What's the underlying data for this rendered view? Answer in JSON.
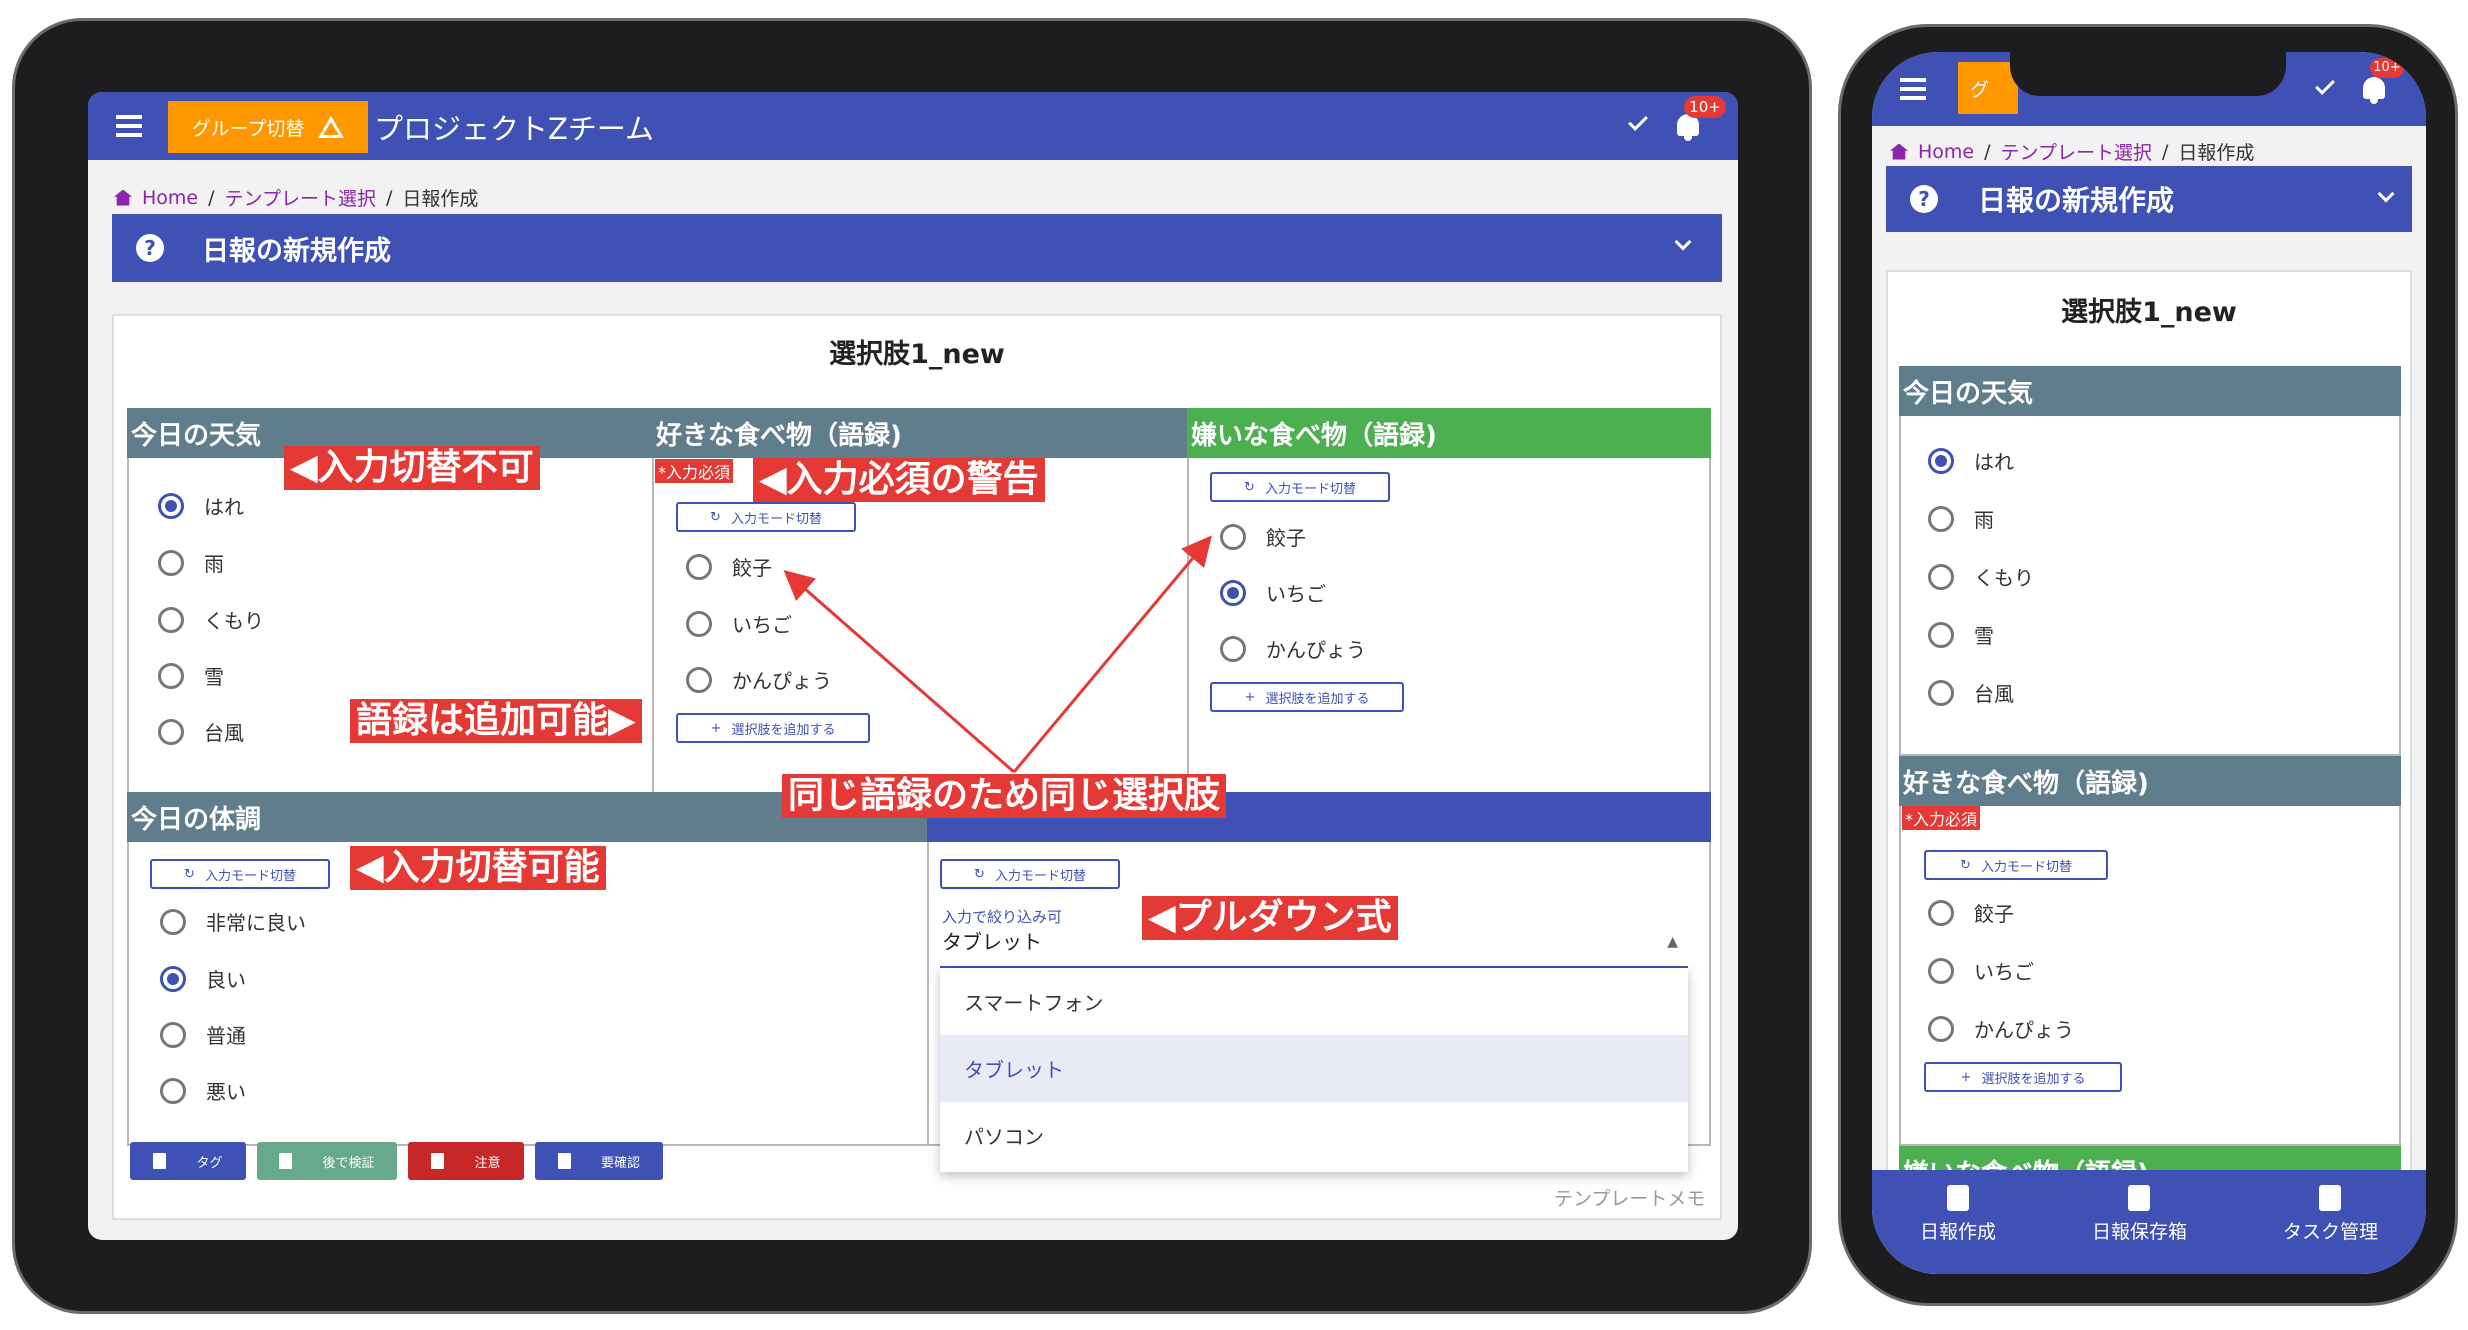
{
  "app": {
    "group_button": "グループ切替",
    "title": "プロジェクトZチーム",
    "notification_badge": "10+",
    "phone_group_button": "グ"
  },
  "breadcrumb": {
    "home": "Home",
    "template": "テンプレート選択",
    "current": "日報作成"
  },
  "banner": {
    "help": "?",
    "title": "日報の新規作成"
  },
  "form": {
    "title": "選択肢1_new",
    "weather": {
      "heading": "今日の天気",
      "options": [
        "はれ",
        "雨",
        "くもり",
        "雪",
        "台風"
      ],
      "selected": "はれ"
    },
    "food_like": {
      "heading": "好きな食べ物（語録)",
      "required": "*入力必須",
      "mode_button": "入力モード切替",
      "options": [
        "餃子",
        "いちご",
        "かんぴょう"
      ],
      "add_button": "選択肢を追加する"
    },
    "food_dislike": {
      "heading": "嫌いな食べ物（語録)",
      "mode_button": "入力モード切替",
      "options": [
        "餃子",
        "いちご",
        "かんぴょう"
      ],
      "selected": "いちご",
      "add_button": "選択肢を追加する"
    },
    "condition": {
      "heading": "今日の体調",
      "mode_button": "入力モード切替",
      "options": [
        "非常に良い",
        "良い",
        "普通",
        "悪い"
      ],
      "selected": "良い"
    },
    "device": {
      "mode_button": "入力モード切替",
      "filter_label": "入力で絞り込み可",
      "value": "タブレット",
      "options": [
        "スマートフォン",
        "タブレット",
        "パソコン"
      ],
      "selected": "タブレット"
    },
    "tags": [
      "タグ",
      "後で検証",
      "注意",
      "要確認"
    ],
    "template_memo": "テンプレートメモ"
  },
  "annotations": {
    "no_switch": "◀入力切替不可",
    "required_warning": "◀入力必須の警告",
    "vocab_addable": "語録は追加可能▶",
    "same_vocab": "同じ語録のため同じ選択肢",
    "switchable": "◀入力切替可能",
    "pulldown": "◀プルダウン式"
  },
  "bottom_nav": [
    "日報作成",
    "日報保存箱",
    "タスク管理"
  ],
  "colors": {
    "primary": "#3f51b5",
    "orange": "#ff9800",
    "slate": "#607d8b",
    "green": "#4caf50",
    "red": "#e53935",
    "teal": "#66a98d",
    "darkred": "#c62828"
  }
}
